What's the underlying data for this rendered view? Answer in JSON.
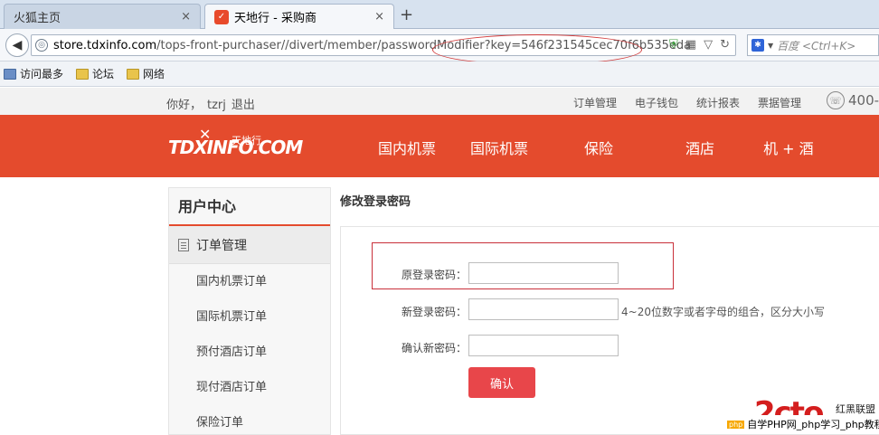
{
  "browser": {
    "tabs": [
      {
        "title": "火狐主页",
        "close": "×"
      },
      {
        "title": "天地行 - 采购商",
        "close": "×"
      }
    ],
    "new_tab": "+",
    "url_host": "store.tdxinfo.com",
    "url_path": "/tops-front-purchaser//divert/member/passwordModifier?key=546f231545cec70f6b535eda",
    "search_placeholder": "百度 <Ctrl+K>",
    "bookmarks": [
      "访问最多",
      "论坛",
      "网络"
    ]
  },
  "site": {
    "greeting": "你好，",
    "username": "tzrj",
    "logout": "退出",
    "top_links": [
      "订单管理",
      "电子钱包",
      "统计报表",
      "票据管理"
    ],
    "phone": "400-",
    "logo_text": "TDXINFO.COM",
    "logo_cn": "天地行",
    "nav": [
      "国内机票",
      "国际机票",
      "保险",
      "酒店",
      "机 + 酒"
    ]
  },
  "sidebar": {
    "title": "用户中心",
    "section": "订单管理",
    "items": [
      "国内机票订单",
      "国际机票订单",
      "预付酒店订单",
      "现付酒店订单",
      "保险订单"
    ]
  },
  "form": {
    "title": "修改登录密码",
    "old_label": "原登录密码：",
    "new_label": "新登录密码：",
    "new_hint": "4~20位数字或者字母的组合，区分大小写",
    "confirm_label": "确认新密码：",
    "old_value": "",
    "new_value": "",
    "confirm_value": "",
    "submit": "确认"
  },
  "watermark": {
    "logo": "2cto",
    "cn": "红黑联盟",
    "php": "php",
    "line": "自学PHP网_php学习_php教程"
  },
  "colors": {
    "brand": "#e44b2d",
    "button": "#e8464a",
    "annotation": "#c9303a"
  }
}
